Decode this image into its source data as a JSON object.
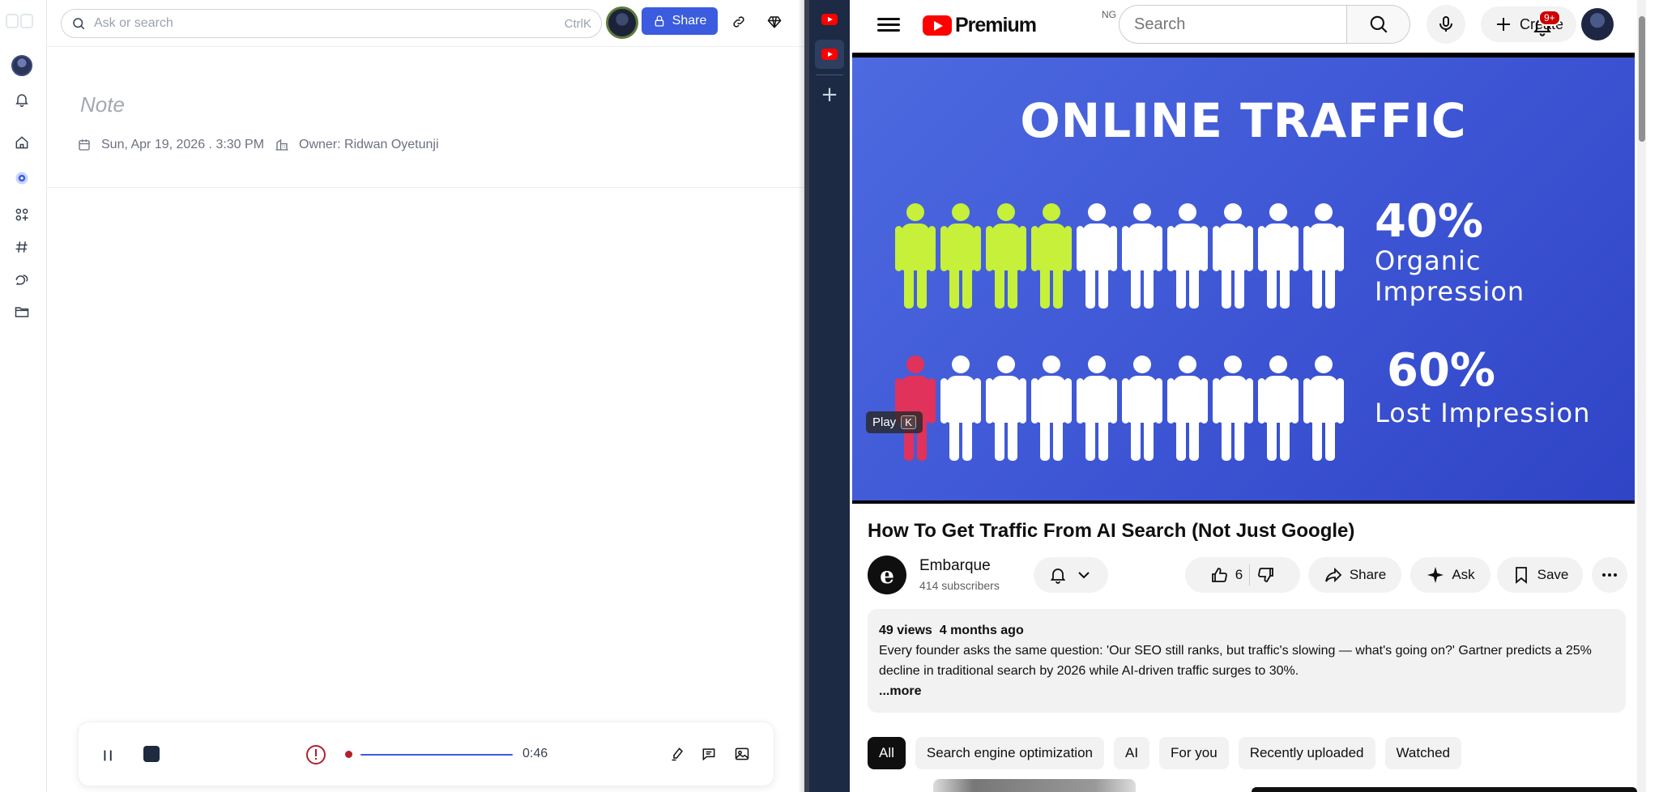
{
  "left_app": {
    "search": {
      "placeholder": "Ask or search",
      "shortcut": "CtrlK"
    },
    "share_label": "Share",
    "note": {
      "title_placeholder": "Note",
      "date": "Sun, Apr 19, 2026 . 3:30 PM",
      "owner": "Owner: Ridwan Oyetunji"
    },
    "recorder": {
      "time": "0:46"
    },
    "rail_icons": [
      "bell-icon",
      "home-icon",
      "activity-icon",
      "apps-icon",
      "hashtag-icon",
      "chat-icon",
      "folder-icon"
    ]
  },
  "tab_rail": {
    "tabs": [
      "youtube-tab",
      "youtube-tab"
    ]
  },
  "youtube": {
    "logo_text": "Premium",
    "country_code": "NG",
    "search_placeholder": "Search",
    "create_label": "Create",
    "notifications_badge": "9+",
    "video": {
      "thumbnail_title": "ONLINE TRAFFIC",
      "stat1_value": "40%",
      "stat1_label": "Organic Impression",
      "stat2_value": "60%",
      "stat2_label": "Lost Impression",
      "tooltip_label": "Play",
      "tooltip_key": "K",
      "colors": {
        "organic": "#c6f03a",
        "lost": "#e0325a",
        "figure": "#ffffff",
        "background": "#3d55d4"
      }
    },
    "title": "How To Get Traffic From AI Search (Not Just Google)",
    "channel": {
      "name": "Embarque",
      "subscribers": "414 subscribers",
      "avatar_letter": "e"
    },
    "actions": {
      "likes": "6",
      "share": "Share",
      "ask": "Ask",
      "save": "Save"
    },
    "description": {
      "views": "49 views",
      "age": "4 months ago",
      "text": "Every founder asks the same question: 'Our SEO still ranks, but traffic's slowing — what's going on?' Gartner predicts a 25% decline in traditional search by 2026 while AI-driven traffic surges to 30%.",
      "more": "...more"
    },
    "chips": [
      "All",
      "Search engine optimization",
      "AI",
      "For you",
      "Recently uploaded",
      "Watched"
    ]
  }
}
